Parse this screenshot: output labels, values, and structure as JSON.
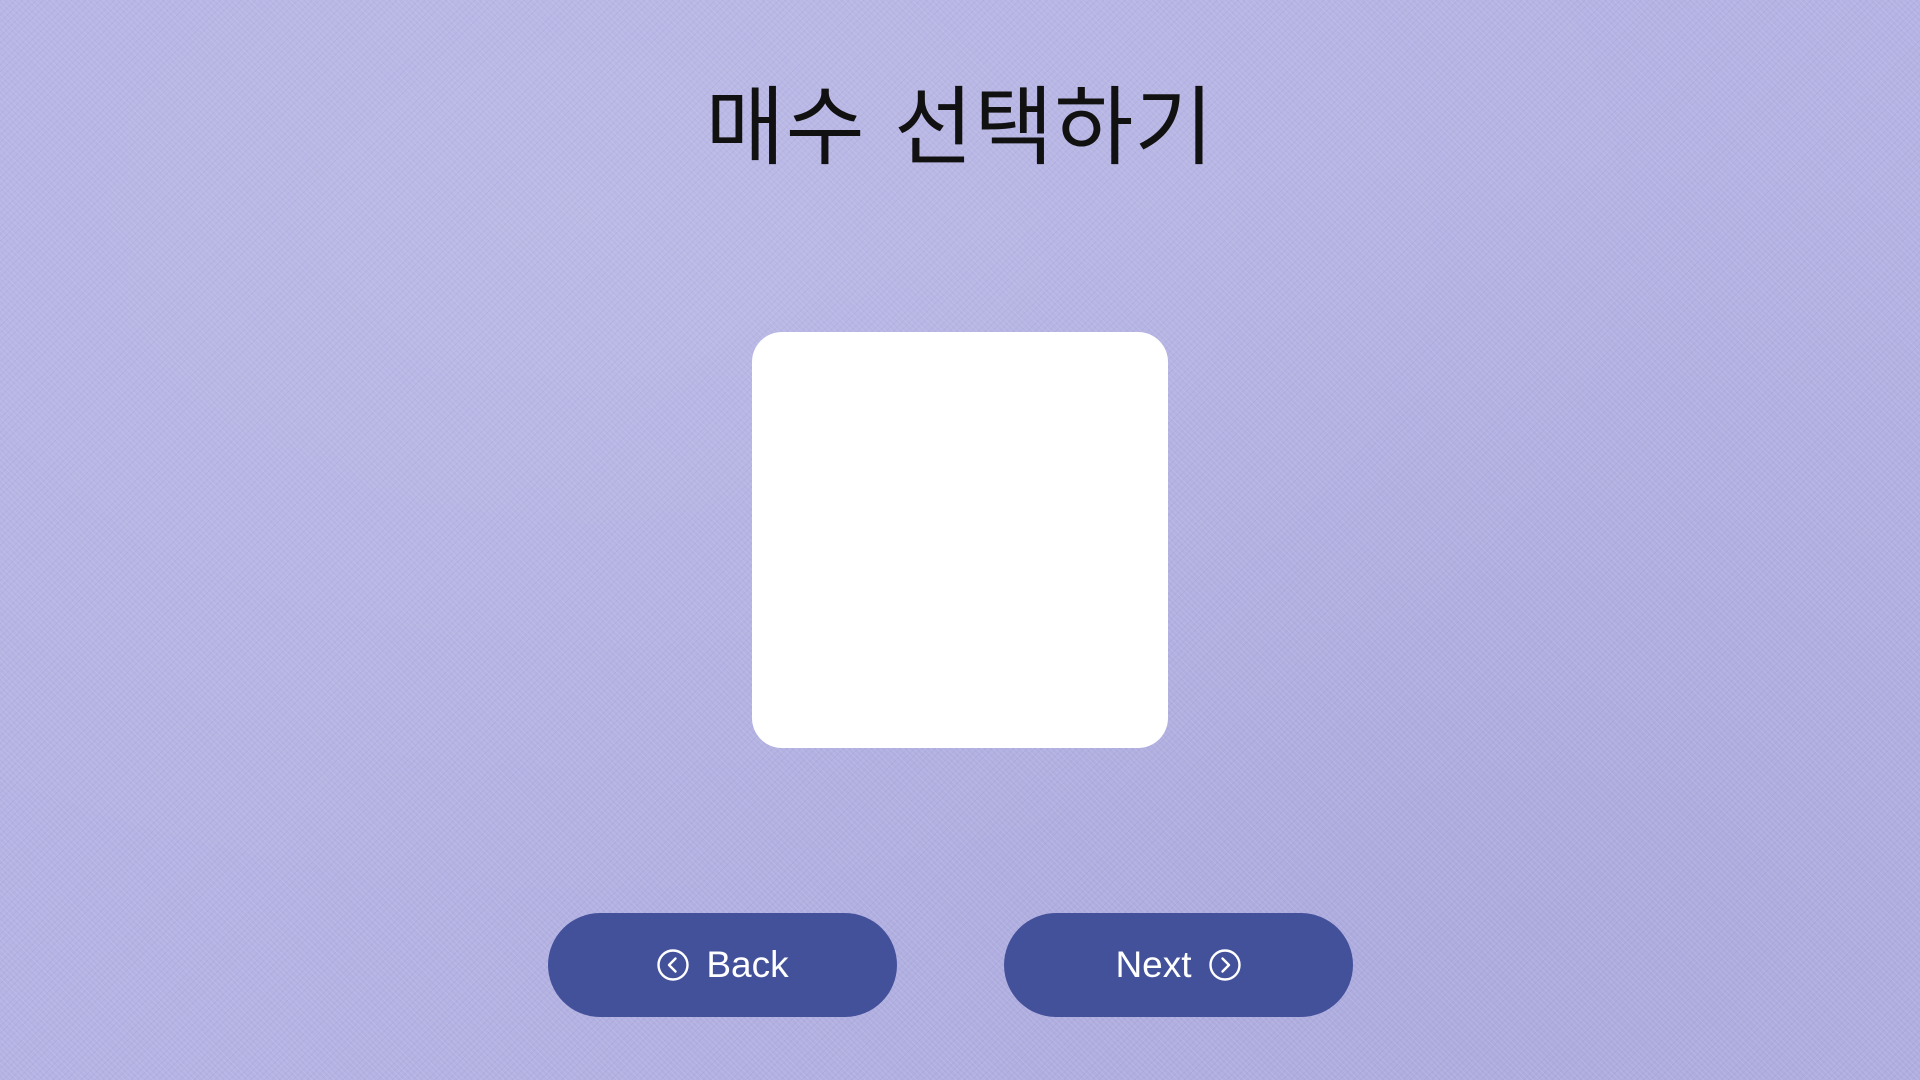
{
  "header": {
    "title": "매수 선택하기"
  },
  "preview": {
    "background_color": "#ffffff"
  },
  "navigation": {
    "back": {
      "label": "Back",
      "icon": "chevron-left-circle-icon"
    },
    "next": {
      "label": "Next",
      "icon": "chevron-right-circle-icon"
    }
  },
  "colors": {
    "background": "#b5b3e3",
    "button": "#43519b",
    "button_text": "#ffffff",
    "title_text": "#111111"
  }
}
